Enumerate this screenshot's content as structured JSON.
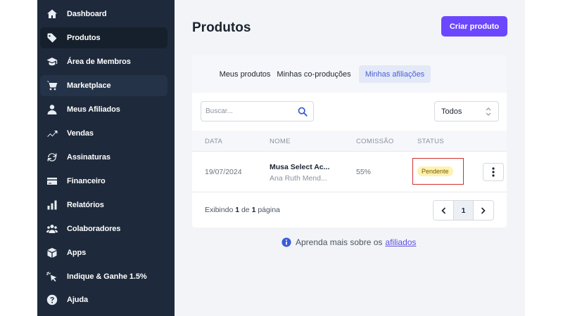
{
  "sidebar": {
    "items": [
      {
        "label": "Dashboard",
        "icon": "home-icon"
      },
      {
        "label": "Produtos",
        "icon": "tag-icon"
      },
      {
        "label": "Área de Membros",
        "icon": "graduation-cap-icon"
      },
      {
        "label": "Marketplace",
        "icon": "cart-icon"
      },
      {
        "label": "Meus Afiliados",
        "icon": "user-icon"
      },
      {
        "label": "Vendas",
        "icon": "trend-up-icon"
      },
      {
        "label": "Assinaturas",
        "icon": "refresh-icon"
      },
      {
        "label": "Financeiro",
        "icon": "credit-card-icon"
      },
      {
        "label": "Relatórios",
        "icon": "bar-chart-icon"
      },
      {
        "label": "Colaboradores",
        "icon": "users-icon"
      },
      {
        "label": "Apps",
        "icon": "box-icon"
      },
      {
        "label": "Indique & Ganhe 1.5%",
        "icon": "pointer-click-icon"
      },
      {
        "label": "Ajuda",
        "icon": "help-circle-icon"
      }
    ]
  },
  "header": {
    "title": "Produtos",
    "create_button": "Criar produto"
  },
  "tabs": [
    {
      "label": "Meus produtos",
      "active": false
    },
    {
      "label": "Minhas co-produções",
      "active": false
    },
    {
      "label": "Minhas afiliações",
      "active": true
    }
  ],
  "filters": {
    "search_placeholder": "Buscar...",
    "select_value": "Todos"
  },
  "table": {
    "columns": [
      "DATA",
      "NOME",
      "COMISSÃO",
      "STATUS"
    ],
    "rows": [
      {
        "date": "19/07/2024",
        "name": "Musa Select Ac...",
        "owner": "Ana Ruth Mend...",
        "commission": "55%",
        "status": "Pendente"
      }
    ]
  },
  "pagination": {
    "text_prefix": "Exibindo",
    "current": "1",
    "text_middle": "de",
    "total": "1",
    "text_suffix": "página",
    "prev": "‹",
    "next": "›"
  },
  "info": {
    "text": "Aprenda mais sobre os",
    "link": "afiliados"
  },
  "colors": {
    "sidebar_bg": "#1e2a3b",
    "accent": "#6c47ff",
    "status_pending_bg": "#fdf2b0",
    "highlight_border": "#d32f2f"
  }
}
